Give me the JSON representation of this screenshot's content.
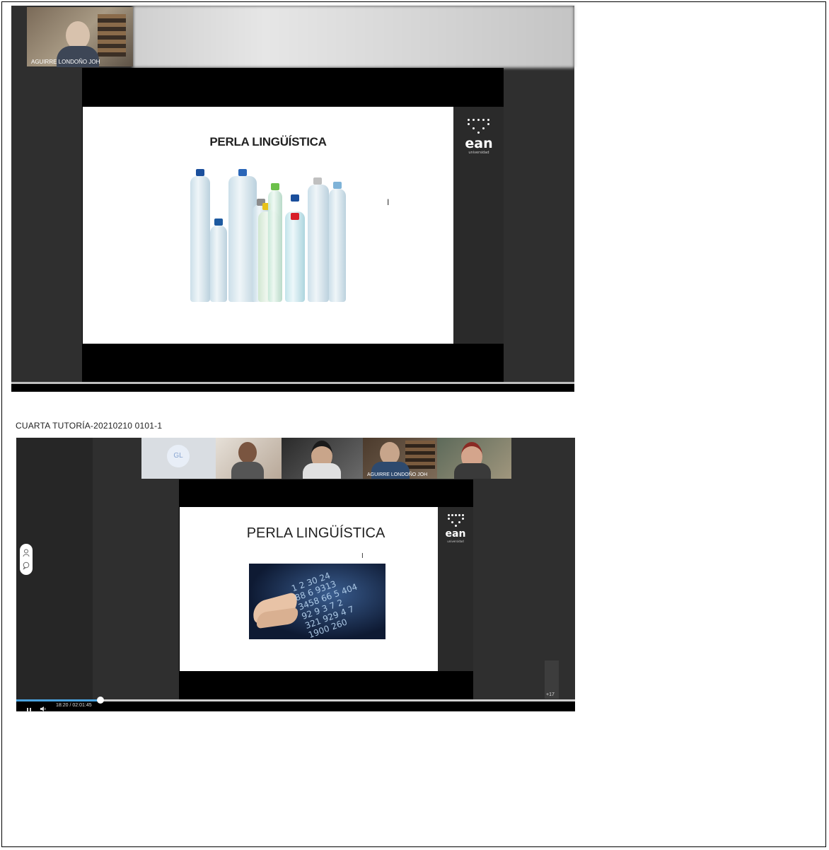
{
  "frame1": {
    "participant_name": "AGUIRRE LONDOÑO JOH",
    "slide_title": "PERLA LINGÜÍSTICA",
    "logo_text": "ean",
    "logo_sub": "universidad"
  },
  "recording": {
    "title": "CUARTA TUTORÍA-20210210 0101-1"
  },
  "frame2": {
    "participants": [
      {
        "name": "",
        "initials": "GL"
      },
      {
        "name": ""
      },
      {
        "name": ""
      },
      {
        "name": "AGUIRRE LONDOÑO JOH"
      },
      {
        "name": ""
      }
    ],
    "slide_title": "PERLA LINGÜÍSTICA",
    "logo_text": "ean",
    "logo_sub": "universidad",
    "more_participants": "+17",
    "player": {
      "time": "18:20 / 02:01:45",
      "progress": 0.151
    }
  },
  "colors": {
    "app_bg": "#2f2f2f",
    "stage_bg": "#000000",
    "progress_fill": "#4aa3df"
  },
  "icons": {
    "play_pause": "pause-icon",
    "volume": "volume-icon",
    "people": "person-icon",
    "chat": "chat-icon",
    "cursor": "text-cursor-icon"
  }
}
